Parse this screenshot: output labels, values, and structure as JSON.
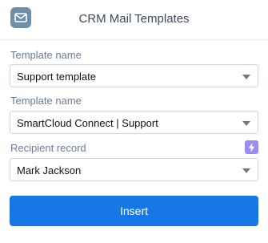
{
  "header": {
    "title": "CRM Mail Templates",
    "icon": "mail-icon"
  },
  "fields": [
    {
      "label": "Template name",
      "value": "Support template"
    },
    {
      "label": "Template name",
      "value": "SmartCloud Connect | Support"
    },
    {
      "label": "Recipient record",
      "value": "Mark Jackson",
      "action_icon": "lightning-bolt-icon"
    }
  ],
  "actions": {
    "insert_label": "Insert"
  },
  "colors": {
    "accent": "#1877e5",
    "bolt_badge": "#9a8cf2",
    "label_text": "#6a7d93",
    "app_icon": "#6e8fa8"
  }
}
